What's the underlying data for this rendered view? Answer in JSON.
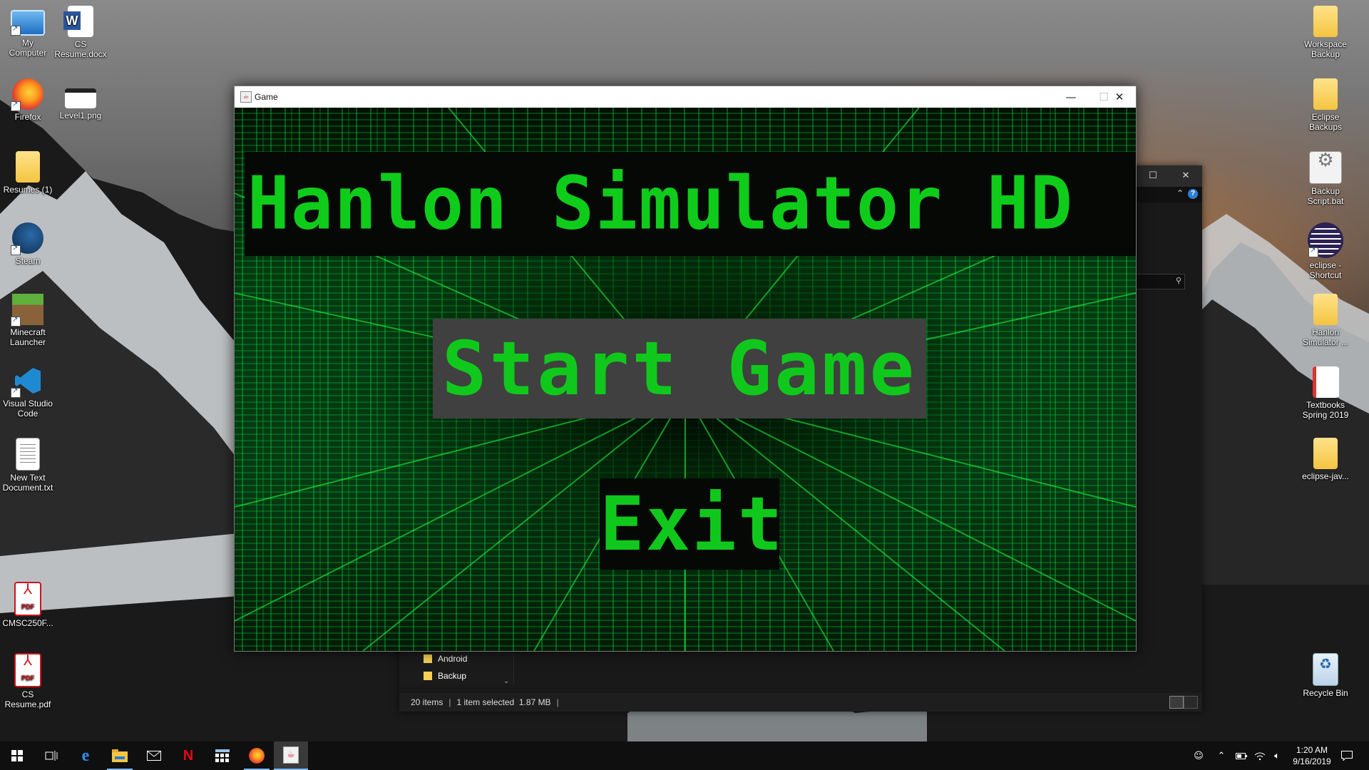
{
  "desktop": {
    "left_icons": [
      {
        "label": "My\nComputer",
        "icon": "computer-icon"
      },
      {
        "label": "CS\nResume.docx",
        "icon": "word-doc-icon"
      },
      {
        "label": "Firefox",
        "icon": "firefox-icon"
      },
      {
        "label": "Level1.png",
        "icon": "image-file-icon"
      },
      {
        "label": "Resumes (1)",
        "icon": "folder-icon"
      },
      {
        "label": "Steam",
        "icon": "steam-icon"
      },
      {
        "label": "Minecraft\nLauncher",
        "icon": "minecraft-icon"
      },
      {
        "label": "Visual Studio\nCode",
        "icon": "vscode-icon"
      },
      {
        "label": "New Text\nDocument.txt",
        "icon": "text-file-icon"
      },
      {
        "label": "CMSC250F...",
        "icon": "pdf-icon"
      },
      {
        "label": "CS\nResume.pdf",
        "icon": "pdf-icon"
      }
    ],
    "right_icons": [
      {
        "label": "Workspace\nBackup",
        "icon": "folder-icon"
      },
      {
        "label": "Eclipse\nBackups",
        "icon": "folder-icon"
      },
      {
        "label": "Backup\nScript.bat",
        "icon": "batch-file-icon"
      },
      {
        "label": "eclipse -\nShortcut",
        "icon": "eclipse-icon"
      },
      {
        "label": "Hanlon\nSimulator ...",
        "icon": "folder-icon"
      },
      {
        "label": "Textbooks\nSpring 2019",
        "icon": "folder-icon"
      },
      {
        "label": "eclipse-jav...",
        "icon": "folder-icon"
      },
      {
        "label": "Recycle Bin",
        "icon": "recycle-bin-icon"
      }
    ]
  },
  "game_window": {
    "title": "Game",
    "heading": "Hanlon Simulator HD",
    "start_label": "Start Game",
    "exit_label": "Exit",
    "minimize": "—",
    "maximize": "☐",
    "close": "✕"
  },
  "explorer": {
    "nav_items": [
      {
        "label": "Android"
      },
      {
        "label": "Backup"
      }
    ],
    "status_items": "20 items",
    "status_selected": "1 item selected",
    "status_size": "1.87 MB",
    "maximize": "☐",
    "close": "✕",
    "help": "?"
  },
  "taskbar": {
    "time": "1:20 AM",
    "date": "9/16/2019",
    "apps": [
      "start-icon",
      "task-view-icon",
      "edge-icon",
      "file-explorer-icon",
      "mail-icon",
      "netflix-icon",
      "calculator-icon",
      "firefox-icon",
      "java-icon"
    ]
  },
  "colors": {
    "matrix_green": "#10c81c",
    "button_gray": "#404040",
    "banner_black": "#050805",
    "taskbar": "#0f0f0f"
  }
}
